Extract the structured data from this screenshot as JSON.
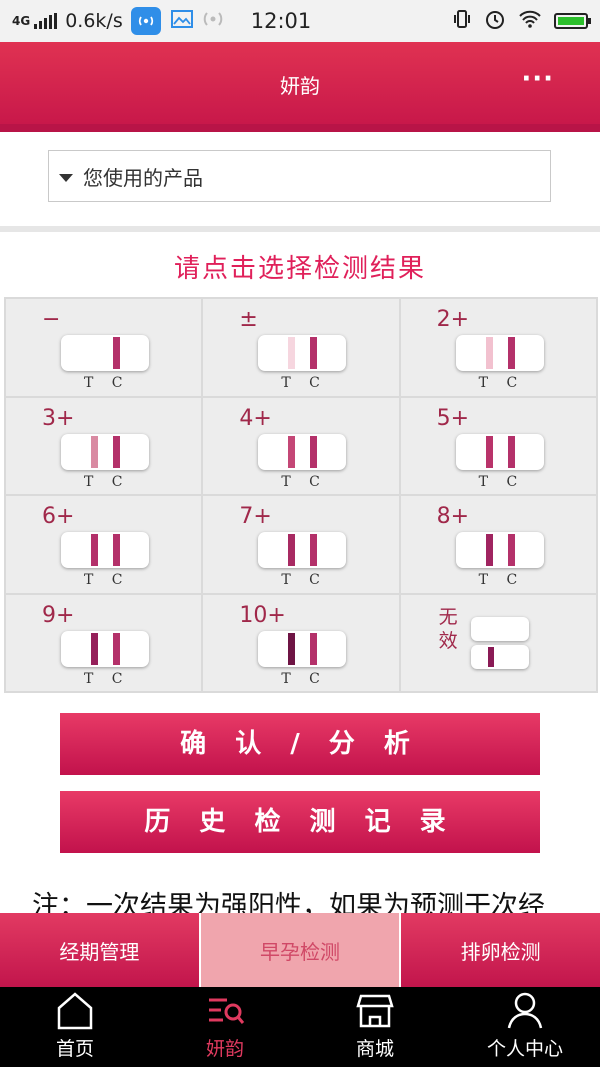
{
  "status_bar": {
    "network": "4G",
    "speed": "0.6k/s",
    "time": "12:01",
    "icons": [
      "signal-icon",
      "wifi-hotspot-icon",
      "image-icon",
      "signal-broadcast-icon",
      "vibrate-icon",
      "alarm-icon",
      "wifi-icon",
      "battery-icon"
    ],
    "battery_color": "#2bbf2b"
  },
  "header": {
    "title": "妍韵",
    "more_label": "···"
  },
  "product_select": {
    "placeholder": "您使用的产品"
  },
  "prompt": "请点击选择检测结果",
  "results": [
    {
      "label": "−",
      "t": "none",
      "c": "#b4316a"
    },
    {
      "label": "±",
      "t": "#f6d6df",
      "c": "#b4316a"
    },
    {
      "label": "2+",
      "t": "#f2c1cf",
      "c": "#b4316a"
    },
    {
      "label": "3+",
      "t": "#d98aa2",
      "c": "#b4316a"
    },
    {
      "label": "4+",
      "t": "#c44776",
      "c": "#b4316a"
    },
    {
      "label": "5+",
      "t": "#b9336a",
      "c": "#b4316a"
    },
    {
      "label": "6+",
      "t": "#b3306a",
      "c": "#b4316a"
    },
    {
      "label": "7+",
      "t": "#a82a62",
      "c": "#b4316a"
    },
    {
      "label": "8+",
      "t": "#a02460",
      "c": "#b4316a"
    },
    {
      "label": "9+",
      "t": "#95205a",
      "c": "#b4316a"
    },
    {
      "label": "10+",
      "t": "#6e1444",
      "c": "#b4316a"
    }
  ],
  "tc_label": "T C",
  "invalid": {
    "label": "无效",
    "line_color": "#8a1a55"
  },
  "buttons": {
    "confirm": "确 认 / 分 析",
    "history": "历 史 检 测 记 录"
  },
  "note_text": "注：一次结果为强阳性，如果为预测干次经",
  "tabs": [
    {
      "label": "经期管理",
      "active": false
    },
    {
      "label": "早孕检测",
      "active": true
    },
    {
      "label": "排卵检测",
      "active": false
    }
  ],
  "bottom_nav": [
    {
      "label": "首页",
      "icon": "home-icon",
      "active": false
    },
    {
      "label": "妍韵",
      "icon": "search-list-icon",
      "active": true
    },
    {
      "label": "商城",
      "icon": "shop-icon",
      "active": false
    },
    {
      "label": "个人中心",
      "icon": "person-icon",
      "active": false
    }
  ],
  "colors": {
    "brand": "#d81f50",
    "active_tab": "#f0a5ad",
    "active_nav": "#e03a5f"
  }
}
